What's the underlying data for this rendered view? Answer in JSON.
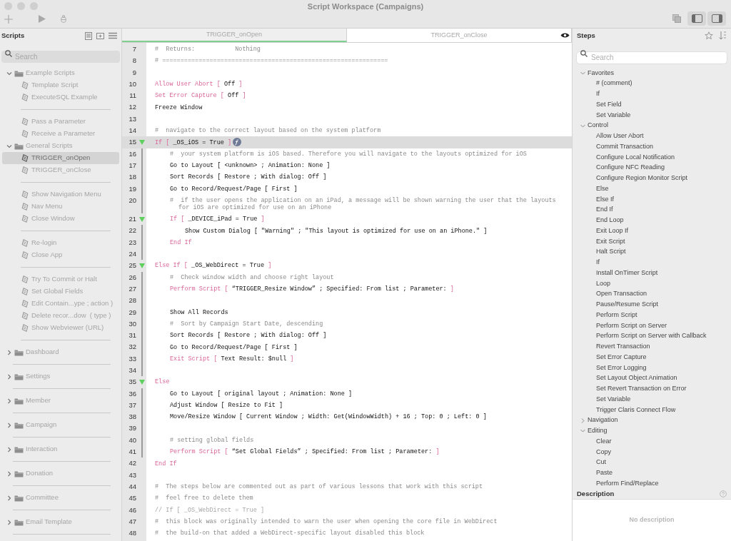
{
  "window": {
    "title": "Script Workspace (Campaigns)"
  },
  "scripts_panel": {
    "title": "Scripts",
    "search": {
      "placeholder": "Search"
    },
    "items": [
      {
        "kind": "folder",
        "label": "Example Scripts",
        "expanded": true,
        "selected": false,
        "children": [
          {
            "kind": "script",
            "label": "Template Script",
            "selected": false
          },
          {
            "kind": "script",
            "label": "ExecuteSQL Example",
            "selected": false
          },
          {
            "kind": "separator"
          },
          {
            "kind": "script",
            "label": "Pass a Parameter",
            "selected": false
          },
          {
            "kind": "script",
            "label": "Receive a Parameter",
            "selected": false
          }
        ]
      },
      {
        "kind": "folder",
        "label": "General Scripts",
        "expanded": true,
        "selected": false,
        "children": [
          {
            "kind": "script",
            "label": "TRIGGER_onOpen",
            "selected": true
          },
          {
            "kind": "script",
            "label": "TRIGGER_onClose",
            "selected": false
          },
          {
            "kind": "separator"
          },
          {
            "kind": "script",
            "label": "Show Navigation Menu",
            "selected": false
          },
          {
            "kind": "script",
            "label": "Nav Menu",
            "selected": false
          },
          {
            "kind": "script",
            "label": "Close Window",
            "selected": false
          },
          {
            "kind": "separator"
          },
          {
            "kind": "script",
            "label": "Re-login",
            "selected": false
          },
          {
            "kind": "script",
            "label": "Close App",
            "selected": false
          },
          {
            "kind": "separator"
          },
          {
            "kind": "script",
            "label": "Try To Commit or Halt",
            "selected": false
          },
          {
            "kind": "script",
            "label": "Set Global Fields",
            "selected": false
          },
          {
            "kind": "script",
            "label": "Edit Contain...ype ; action )",
            "selected": false
          },
          {
            "kind": "script",
            "label": "Delete recor...dow  ( type )",
            "selected": false
          },
          {
            "kind": "script",
            "label": "Show Webviewer (URL)",
            "selected": false
          },
          {
            "kind": "separator"
          }
        ]
      },
      {
        "kind": "folder",
        "label": "Dashboard",
        "expanded": false,
        "selected": false
      },
      {
        "kind": "separator"
      },
      {
        "kind": "folder",
        "label": "Settings",
        "expanded": false,
        "selected": false
      },
      {
        "kind": "separator"
      },
      {
        "kind": "folder",
        "label": "Member",
        "expanded": false,
        "selected": false
      },
      {
        "kind": "separator"
      },
      {
        "kind": "folder",
        "label": "Campaign",
        "expanded": false,
        "selected": false
      },
      {
        "kind": "separator"
      },
      {
        "kind": "folder",
        "label": "Interaction",
        "expanded": false,
        "selected": false
      },
      {
        "kind": "separator"
      },
      {
        "kind": "folder",
        "label": "Donation",
        "expanded": false,
        "selected": false
      },
      {
        "kind": "separator"
      },
      {
        "kind": "folder",
        "label": "Committee",
        "expanded": false,
        "selected": false
      },
      {
        "kind": "separator"
      },
      {
        "kind": "folder",
        "label": "Email Template",
        "expanded": false,
        "selected": false
      },
      {
        "kind": "separator"
      }
    ]
  },
  "editor": {
    "tabs": [
      {
        "label": "TRIGGER_onOpen",
        "selected": true
      },
      {
        "label": "TRIGGER_onClose",
        "selected": false
      }
    ],
    "lines": [
      {
        "number": "7",
        "selected": false,
        "parts": [
          {
            "kind": "comment",
            "text": "#  Returns:           Nothing"
          }
        ]
      },
      {
        "number": "8",
        "selected": false,
        "parts": [
          {
            "kind": "comment",
            "text": "# =============================================================="
          }
        ]
      },
      {
        "number": "9",
        "selected": false
      },
      {
        "number": "10",
        "selected": false,
        "parts": [
          {
            "kind": "control",
            "text": "Allow User Abort ["
          },
          {
            "kind": "arg",
            "text": "Off"
          },
          {
            "kind": "control",
            "text": "]"
          }
        ]
      },
      {
        "number": "11",
        "selected": false,
        "parts": [
          {
            "kind": "control",
            "text": "Set Error Capture ["
          },
          {
            "kind": "arg",
            "text": "Off"
          },
          {
            "kind": "control",
            "text": "]"
          }
        ]
      },
      {
        "number": "12",
        "selected": false,
        "parts": [
          {
            "kind": "arg",
            "text": "Freeze Window"
          }
        ]
      },
      {
        "number": "13",
        "selected": false
      },
      {
        "number": "14",
        "selected": false,
        "parts": [
          {
            "kind": "comment",
            "text": "#  navigate to the correct layout based on the system platform"
          }
        ]
      },
      {
        "number": "15",
        "selected": true,
        "formula": true,
        "expanded": true,
        "parts": [
          {
            "kind": "control",
            "text": "If ["
          },
          {
            "kind": "arg",
            "text": "_OS_iOS = True"
          },
          {
            "kind": "control",
            "text": "]"
          }
        ],
        "children": [
          {
            "number": "16",
            "selected": false,
            "parts": [
              {
                "kind": "comment",
                "text": "#  your system platform is iOS based. Therefore you will navigate to the layouts optimized for iOS"
              }
            ]
          },
          {
            "number": "17",
            "selected": false,
            "parts": [
              {
                "kind": "arg",
                "text": "Go to Layout [ <unknown> ; Animation: None ]"
              }
            ]
          },
          {
            "number": "18",
            "selected": false,
            "parts": [
              {
                "kind": "arg",
                "text": "Sort Records [ Restore ; With dialog: Off ]"
              }
            ]
          },
          {
            "number": "19",
            "selected": false,
            "parts": [
              {
                "kind": "arg",
                "text": "Go to Record/Request/Page [ First ]"
              }
            ]
          },
          {
            "number": "20",
            "selected": false,
            "parts": [
              {
                "kind": "comment",
                "text": "#  if the user opens the application on an iPad, a message will be shown warning the user that the layouts for iOS are optimized for use on an iPhone"
              }
            ]
          },
          {
            "number": "21",
            "selected": false,
            "expanded": true,
            "parts": [
              {
                "kind": "control",
                "text": "If ["
              },
              {
                "kind": "arg",
                "text": "_DEVICE_iPad = True"
              },
              {
                "kind": "control",
                "text": "]"
              }
            ],
            "children": [
              {
                "number": "22",
                "selected": false,
                "parts": [
                  {
                    "kind": "arg",
                    "text": "Show Custom Dialog [ \"Warning\" ; \"This layout is optimized for use on an iPhone.\" ]"
                  }
                ]
              }
            ]
          },
          {
            "number": "23",
            "selected": false,
            "parts": [
              {
                "kind": "control",
                "text": "End If"
              }
            ]
          },
          {
            "number": "24",
            "selected": false
          }
        ]
      },
      {
        "number": "25",
        "selected": false,
        "expanded": true,
        "parts": [
          {
            "kind": "control",
            "text": "Else If ["
          },
          {
            "kind": "arg",
            "text": "_OS_WebDirect = True"
          },
          {
            "kind": "control",
            "text": "]"
          }
        ],
        "children": [
          {
            "number": "26",
            "selected": false,
            "parts": [
              {
                "kind": "comment",
                "text": "#  Check window width and choose right layout"
              }
            ]
          },
          {
            "number": "27",
            "selected": false,
            "parts": [
              {
                "kind": "control",
                "text": "Perform Script ["
              },
              {
                "kind": "arg",
                "text": "“TRIGGER_Resize Window” ; Specified: From list ; Parameter:"
              },
              {
                "kind": "control",
                "text": "]"
              }
            ]
          },
          {
            "number": "28",
            "selected": false
          },
          {
            "number": "29",
            "selected": false,
            "parts": [
              {
                "kind": "arg",
                "text": "Show All Records"
              }
            ]
          },
          {
            "number": "30",
            "selected": false,
            "parts": [
              {
                "kind": "comment",
                "text": "#  Sort by Campaign Start Date, descending"
              }
            ]
          },
          {
            "number": "31",
            "selected": false,
            "parts": [
              {
                "kind": "arg",
                "text": "Sort Records [ Restore ; With dialog: Off ]"
              }
            ]
          },
          {
            "number": "32",
            "selected": false,
            "parts": [
              {
                "kind": "arg",
                "text": "Go to Record/Request/Page [ First ]"
              }
            ]
          },
          {
            "number": "33",
            "selected": false,
            "parts": [
              {
                "kind": "control",
                "text": "Exit Script ["
              },
              {
                "kind": "arg",
                "text": "Text Result: $null"
              },
              {
                "kind": "control",
                "text": "]"
              }
            ]
          },
          {
            "number": "34",
            "selected": false
          }
        ]
      },
      {
        "number": "35",
        "selected": false,
        "expanded": true,
        "parts": [
          {
            "kind": "control",
            "text": "Else"
          }
        ],
        "children": [
          {
            "number": "36",
            "selected": false,
            "parts": [
              {
                "kind": "arg",
                "text": "Go to Layout [ original layout ; Animation: None ]"
              }
            ]
          },
          {
            "number": "37",
            "selected": false,
            "parts": [
              {
                "kind": "arg",
                "text": "Adjust Window [ Resize to Fit ]"
              }
            ]
          },
          {
            "number": "38",
            "selected": false,
            "parts": [
              {
                "kind": "arg",
                "text": "Move/Resize Window [ Current Window ; Width: Get(WindowWidth) + 16 ; Top: 0 ; Left: 0 ]"
              }
            ]
          },
          {
            "number": "39",
            "selected": false
          },
          {
            "number": "40",
            "selected": false,
            "parts": [
              {
                "kind": "comment",
                "text": "# setting global fields"
              }
            ]
          },
          {
            "number": "41",
            "selected": false,
            "parts": [
              {
                "kind": "control",
                "text": "Perform Script ["
              },
              {
                "kind": "arg",
                "text": "“Set Global Fields” ; Specified: From list ; Parameter:"
              },
              {
                "kind": "control",
                "text": "]"
              }
            ]
          }
        ]
      },
      {
        "number": "42",
        "selected": false,
        "parts": [
          {
            "kind": "control",
            "text": "End If"
          }
        ]
      },
      {
        "number": "43",
        "selected": false
      },
      {
        "number": "44",
        "selected": false,
        "parts": [
          {
            "kind": "comment",
            "text": "#  The steps below are commented out as part of various lessons that work with this script"
          }
        ]
      },
      {
        "number": "45",
        "selected": false,
        "parts": [
          {
            "kind": "comment",
            "text": "#  feel free to delete them"
          }
        ]
      },
      {
        "number": "46",
        "selected": false,
        "parts": [
          {
            "kind": "disabled",
            "text": "// If [ _OS_WebDirect = True ]"
          }
        ]
      },
      {
        "number": "47",
        "selected": false,
        "parts": [
          {
            "kind": "comment",
            "text": "#  this block was originally intended to warn the user when opening the core file in WebDirect"
          }
        ]
      },
      {
        "number": "48",
        "selected": false,
        "parts": [
          {
            "kind": "comment",
            "text": "#  the build-on that added a WebDirect-specific layout disabled this block"
          }
        ]
      }
    ]
  },
  "steps_panel": {
    "title": "Steps",
    "search": {
      "placeholder": "Search"
    },
    "groups": [
      {
        "label": "Favorites",
        "expanded": true,
        "items": [
          "# (comment)",
          "If",
          "Set Field",
          "Set Variable"
        ]
      },
      {
        "label": "Control",
        "expanded": true,
        "items": [
          "Allow User Abort",
          "Commit Transaction",
          "Configure Local Notification",
          "Configure NFC Reading",
          "Configure Region Monitor Script",
          "Else",
          "Else If",
          "End If",
          "End Loop",
          "Exit Loop If",
          "Exit Script",
          "Halt Script",
          "If",
          "Install OnTimer Script",
          "Loop",
          "Open Transaction",
          "Pause/Resume Script",
          "Perform Script",
          "Perform Script on Server",
          "Perform Script on Server with Callback",
          "Revert Transaction",
          "Set Error Capture",
          "Set Error Logging",
          "Set Layout Object Animation",
          "Set Revert Transaction on Error",
          "Set Variable",
          "Trigger Claris Connect Flow"
        ]
      },
      {
        "label": "Navigation",
        "expanded": false
      },
      {
        "label": "Editing",
        "expanded": true,
        "items": [
          "Clear",
          "Copy",
          "Cut",
          "Paste",
          "Perform Find/Replace"
        ]
      }
    ]
  },
  "description": {
    "title": "Description",
    "text": "No description"
  }
}
